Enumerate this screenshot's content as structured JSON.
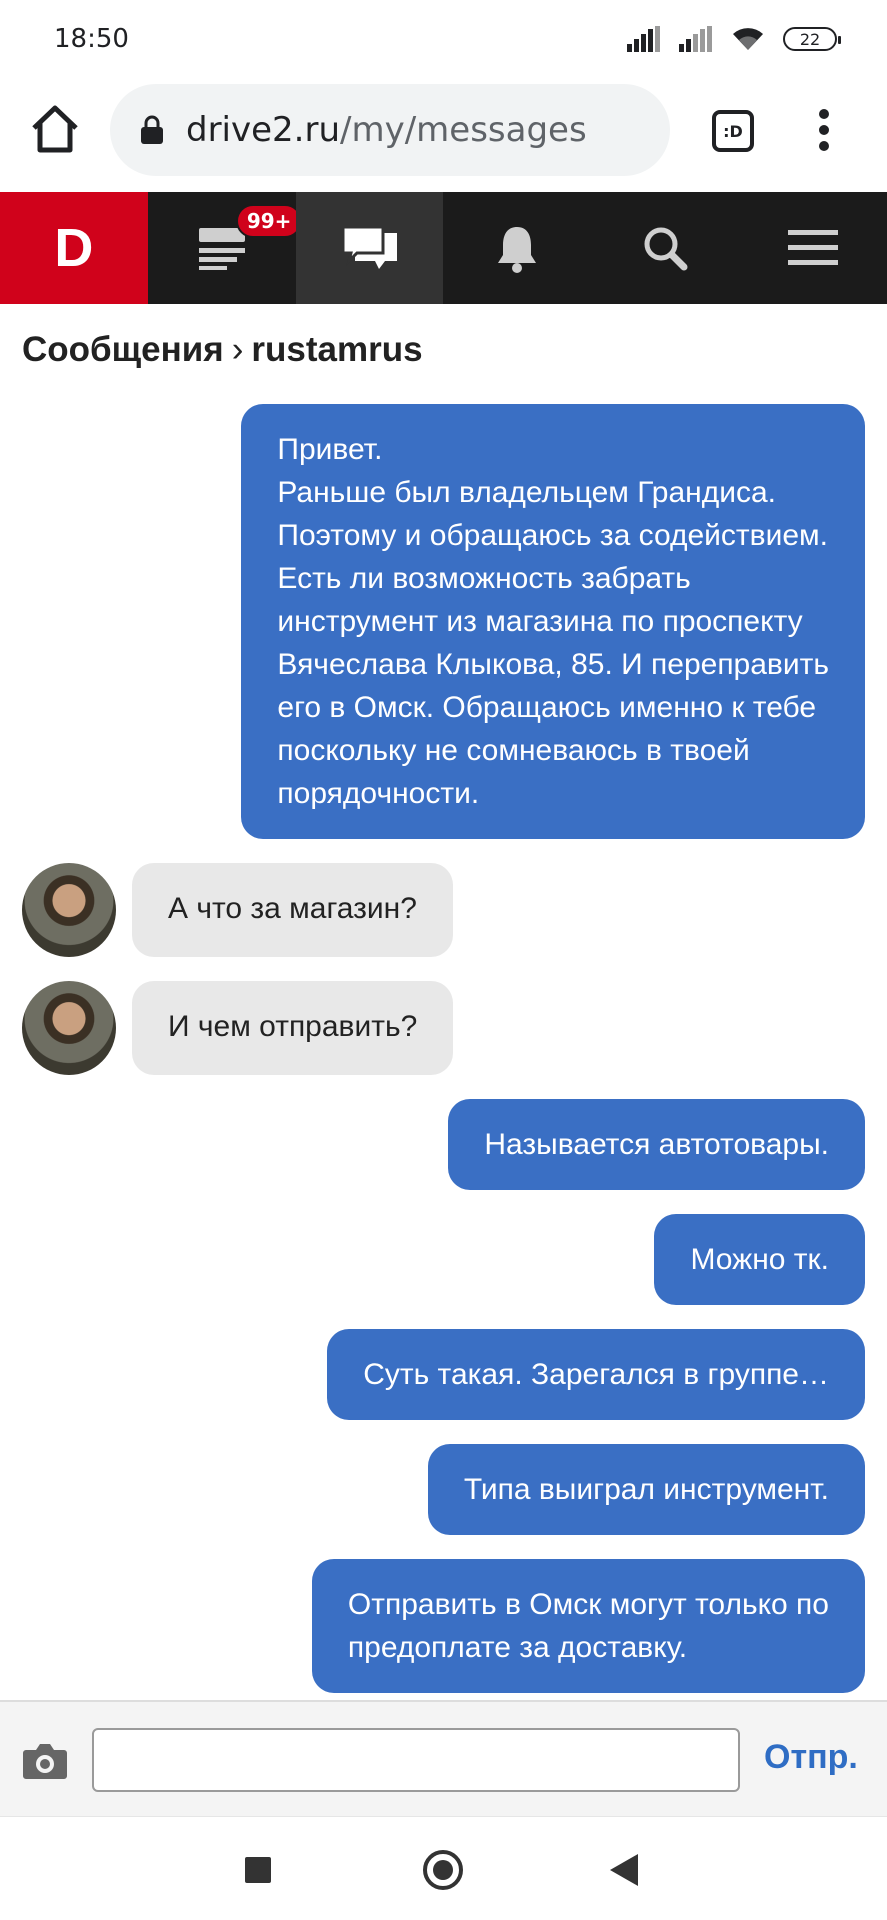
{
  "status_bar": {
    "time": "18:50",
    "battery": "22",
    "icons": [
      "signal-icon",
      "signal-icon",
      "wifi-icon",
      "battery-icon"
    ]
  },
  "browser": {
    "url_host": "drive2.ru",
    "url_path": "/my/messages",
    "tab_label": ":D"
  },
  "site_nav": {
    "logo": "D",
    "feed_badge": "99+",
    "items": [
      "feed-icon",
      "messages-icon",
      "bell-icon",
      "search-icon",
      "menu-icon"
    ]
  },
  "page": {
    "section": "Сообщения",
    "separator": "›",
    "user": "rustamrus"
  },
  "messages": [
    {
      "dir": "out",
      "lines": [
        "Привет.",
        "Раньше был владельцем Грандиса.",
        "Поэтому и обращаюсь за содействием.",
        "Есть ли возможность забрать",
        "инструмент из магазина по проспекту",
        "Вячеслава Клыкова, 85. И переправить",
        "его в Омск. Обращаюсь именно к тебе",
        "поскольку не сомневаюсь в твоей",
        "порядочности."
      ]
    },
    {
      "dir": "in",
      "lines": [
        "А что за магазин?"
      ]
    },
    {
      "dir": "in",
      "lines": [
        "И чем отправить?"
      ]
    },
    {
      "dir": "out",
      "lines": [
        "Называется автотовары."
      ]
    },
    {
      "dir": "out",
      "lines": [
        "Можно тк."
      ]
    },
    {
      "dir": "out",
      "lines": [
        "Суть такая. Зарегался в группе…"
      ]
    },
    {
      "dir": "out",
      "lines": [
        "Типа выиграл инструмент."
      ]
    },
    {
      "dir": "out",
      "lines": [
        "Отправить в Омск могут только по",
        "предоплате за доставку."
      ]
    }
  ],
  "composer": {
    "input_value": "",
    "input_placeholder": "",
    "send_label": "Отпр."
  },
  "colors": {
    "brand_red": "#d0021b",
    "nav_dark": "#1b1b1b",
    "outgoing_bubble": "#3a6fc4",
    "incoming_bubble": "#e8e8e8",
    "send_link": "#2f6dc4"
  }
}
